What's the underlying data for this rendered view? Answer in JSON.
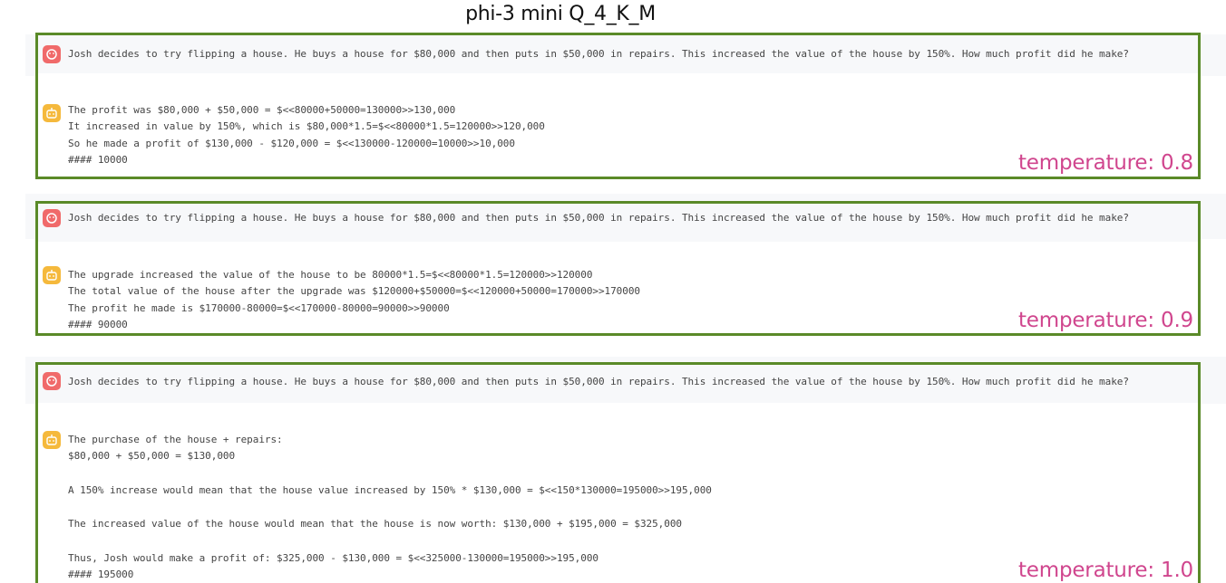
{
  "title": "phi-3 mini Q_4_K_M",
  "question": "Josh decides to try flipping a house. He buys a house for $80,000 and then puts in $50,000 in repairs. This increased the value of the house by 150%. How much profit did he make?",
  "runs": [
    {
      "temperature_label": "temperature: 0.8",
      "answer_lines": [
        "The profit was $80,000 + $50,000 = $<<80000+50000=130000>>130,000",
        "It increased in value by 150%, which is $80,000*1.5=$<<80000*1.5=120000>>120,000",
        "So he made a profit of $130,000 - $120,000 = $<<130000-120000=10000>>10,000",
        "#### 10000"
      ]
    },
    {
      "temperature_label": "temperature: 0.9",
      "answer_lines": [
        "The upgrade increased the value of the house to be 80000*1.5=$<<80000*1.5=120000>>120000",
        "The total value of the house after the upgrade was $120000+$50000=$<<120000+50000=170000>>170000",
        "The profit he made is $170000-80000=$<<170000-80000=90000>>90000",
        "#### 90000"
      ]
    },
    {
      "temperature_label": "temperature: 1.0",
      "answer_lines": [
        "The purchase of the house + repairs:",
        "$80,000 + $50,000 = $130,000",
        "A 150% increase would mean that the house value increased by 150% * $130,000 = $<<150*130000=195000>>195,000",
        "The increased value of the house would mean that the house is now worth: $130,000 + $195,000 = $325,000",
        "Thus, Josh would make a profit of: $325,000 - $130,000 = $<<325000-130000=195000>>195,000",
        "#### 195000"
      ]
    }
  ]
}
